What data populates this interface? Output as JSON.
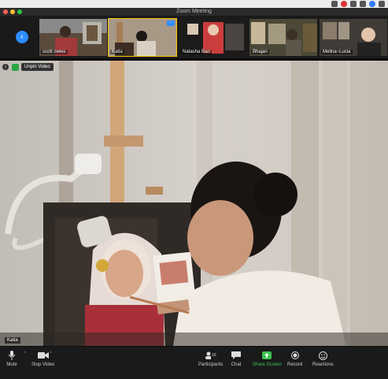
{
  "window": {
    "title": "Zoom Meeting"
  },
  "strip": {
    "nav_icon": "chevron-left-icon",
    "thumbnails": [
      {
        "name": "scott owles",
        "active": false
      },
      {
        "name": "Katia",
        "active": true
      },
      {
        "name": "Natasha Barr",
        "active": false
      },
      {
        "name": "Bhajan",
        "active": false
      },
      {
        "name": "Melina~Lucia",
        "active": false
      }
    ]
  },
  "video": {
    "unpin_label": "Unpin Video",
    "speaker_name": "Katia"
  },
  "toolbar": {
    "mute_label": "Mute",
    "stop_video_label": "Stop Video",
    "participants_label": "Participants",
    "participants_count": "16",
    "chat_label": "Chat",
    "share_label": "Share Screen",
    "record_label": "Record",
    "reactions_label": "Reactions"
  },
  "colors": {
    "accent": "#2d8cff",
    "share": "#3cc34f",
    "active_border": "#f5c400"
  }
}
